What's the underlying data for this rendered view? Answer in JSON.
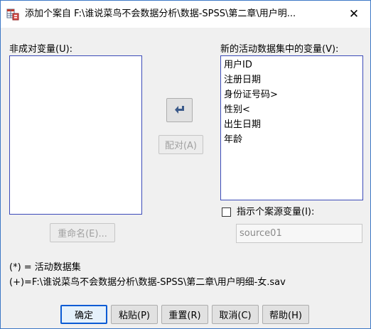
{
  "window": {
    "title": "添加个案自 F:\\谁说菜鸟不会数据分析\\数据-SPSS\\第二章\\用户明...",
    "close_symbol": "✕"
  },
  "left_panel": {
    "label": "非成对变量(U):",
    "items": []
  },
  "right_panel": {
    "label": "新的活动数据集中的变量(V):",
    "items": [
      "用户ID",
      "注册日期",
      "身份证号码>",
      "性别<",
      "出生日期",
      "年龄"
    ]
  },
  "pair_button": {
    "label": "配对(A)"
  },
  "rename_button": {
    "label": "重命名(E)..."
  },
  "indicator": {
    "checkbox_label": "指示个案源变量(I):",
    "checked": false,
    "input_value": "source01"
  },
  "notes": {
    "active_line": "(*) = 活动数据集",
    "file_line": "(+)=F:\\谁说菜鸟不会数据分析\\数据-SPSS\\第二章\\用户明细-女.sav"
  },
  "footer": {
    "ok_label": "确定",
    "paste_label": "粘贴(P)",
    "reset_label": "重置(R)",
    "cancel_label": "取消(C)",
    "help_label": "帮助(H)"
  },
  "colors": {
    "accent": "#0a5bd4",
    "list_border": "#3b4ab8",
    "arrow": "#3b5a8a"
  },
  "icons": {
    "app": "spss-table-icon",
    "arrow": "left-arrow-icon",
    "close": "close-icon"
  }
}
